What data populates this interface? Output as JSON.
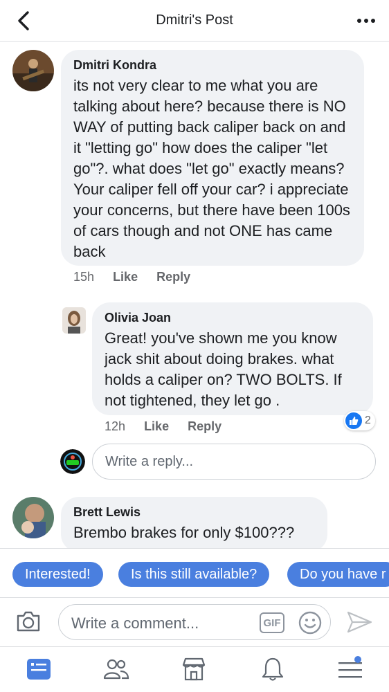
{
  "header": {
    "title": "Dmitri's Post"
  },
  "comments": [
    {
      "author": "Dmitri Kondra",
      "text": "its not very clear to me what you are talking about here? because there is NO WAY of putting back caliper back on and it \"letting go\" how does the caliper \"let go\"?. what does \"let go\" exactly means? Your caliper fell off your car? i appreciate your concerns, but there have been 100s of cars though and not ONE has came back",
      "time": "15h",
      "like": "Like",
      "reply": "Reply"
    },
    {
      "author": "Olivia Joan",
      "text": "Great! you've shown me you know jack shit about doing brakes. what holds a caliper on? TWO BOLTS. If not tightened, they let go .",
      "time": "12h",
      "like": "Like",
      "reply": "Reply",
      "reaction_count": "2"
    },
    {
      "author": "Brett Lewis",
      "text": "Brembo brakes for only $100???"
    }
  ],
  "reply_box": {
    "placeholder": "Write a reply..."
  },
  "quick_replies": [
    "Interested!",
    "Is this still available?",
    "Do you have r"
  ],
  "composer": {
    "placeholder": "Write a comment...",
    "gif_label": "GIF"
  },
  "tabs": [
    "news-feed",
    "friends",
    "marketplace",
    "notifications",
    "menu"
  ],
  "colors": {
    "accent": "#1877f2",
    "chip": "#4a7fdf",
    "bubble": "#f0f2f5"
  }
}
